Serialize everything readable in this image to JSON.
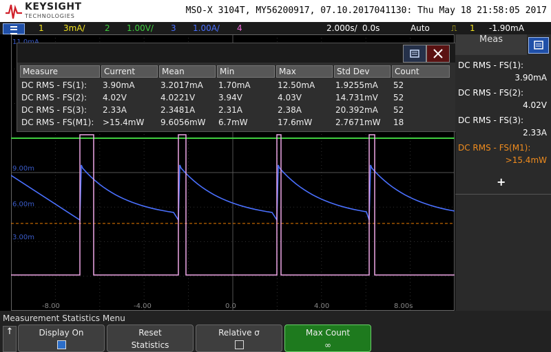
{
  "header": {
    "brand": "KEYSIGHT",
    "sub": "TECHNOLOGIES",
    "title": "MSO-X 3104T, MY56200917, 07.10.2017041130: Thu May 18 21:58:05 2017"
  },
  "status_bar": {
    "ch1_num": "1",
    "ch1_scale": "3mA/",
    "ch2_num": "2",
    "ch2_scale": "1.00V/",
    "ch3_num": "3",
    "ch3_scale": "1.00A/",
    "ch4_num": "4",
    "timebase": "2.000s/",
    "delay": "0.0s",
    "trigger_mode": "Auto",
    "trigger_icon": "trigger-edge-icon",
    "trigger_ch": "1",
    "trigger_level": "-1.90mA",
    "colors": {
      "ch1": "#f2e321",
      "ch2": "#3fcf3f",
      "ch3": "#4a70ff",
      "ch4": "#f06ad8",
      "math": "#f08000"
    }
  },
  "graticule": {
    "y_labels_left": [
      "11.0mA",
      "9.00m",
      "6.00m",
      "3.00m"
    ],
    "x_ticks": [
      "-8.00",
      "-4.00",
      "0.0",
      "4.00",
      "8.00s"
    ]
  },
  "measurement_window": {
    "headers": [
      "Measure",
      "Current",
      "Mean",
      "Min",
      "Max",
      "Std Dev",
      "Count"
    ],
    "rows": [
      {
        "measure": "DC RMS - FS(1):",
        "current": "3.90mA",
        "mean": "3.2017mA",
        "min": "1.70mA",
        "max": "12.50mA",
        "std": "1.9255mA",
        "count": "52"
      },
      {
        "measure": "DC RMS - FS(2):",
        "current": "4.02V",
        "mean": "4.0221V",
        "min": "3.94V",
        "max": "4.03V",
        "std": "14.731mV",
        "count": "52"
      },
      {
        "measure": "DC RMS - FS(3):",
        "current": "2.33A",
        "mean": "2.3481A",
        "min": "2.31A",
        "max": "2.38A",
        "std": "20.392mA",
        "count": "52"
      },
      {
        "measure": "DC RMS - FS(M1):",
        "current": ">15.4mW",
        "mean": "9.6056mW",
        "min": "6.7mW",
        "max": "17.6mW",
        "std": "2.7671mW",
        "count": "18"
      }
    ]
  },
  "side_panel": {
    "title": "Meas",
    "items": [
      {
        "label": "DC RMS - FS(1):",
        "value": "3.90mA",
        "color": "#ffffff"
      },
      {
        "label": "DC RMS - FS(2):",
        "value": "4.02V",
        "color": "#ffffff"
      },
      {
        "label": "DC RMS - FS(3):",
        "value": "2.33A",
        "color": "#ffffff"
      },
      {
        "label": "DC RMS - FS(M1):",
        "value": ">15.4mW",
        "color": "#f08c1e"
      }
    ],
    "add_label": "+"
  },
  "softkeys": {
    "menu_title": "Measurement Statistics Menu",
    "back_label": "↑",
    "display_on": "Display On",
    "reset_1": "Reset",
    "reset_2": "Statistics",
    "relative": "Relative σ",
    "max_count": "Max Count",
    "max_count_value": "∞"
  }
}
